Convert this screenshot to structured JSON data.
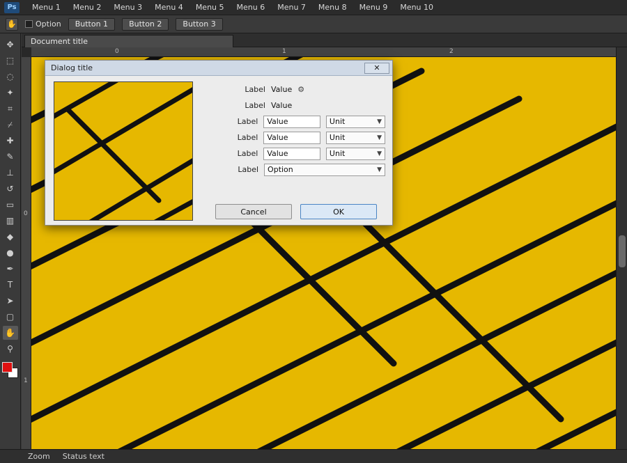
{
  "app": {
    "logo": "Ps"
  },
  "menu": [
    "Menu 1",
    "Menu 2",
    "Menu 3",
    "Menu 4",
    "Menu 5",
    "Menu 6",
    "Menu 7",
    "Menu 8",
    "Menu 9",
    "Menu 10"
  ],
  "options": {
    "tool_icon": "hand-icon",
    "checkbox_label": "Option",
    "buttons": [
      "Button 1",
      "Button 2",
      "Button 3"
    ]
  },
  "document": {
    "tab_title": "Document title"
  },
  "rulers": {
    "top": [
      "0",
      "1",
      "2"
    ],
    "left": [
      "0",
      "1"
    ]
  },
  "tools": [
    "move-icon",
    "marquee-icon",
    "lasso-icon",
    "magic-wand-icon",
    "crop-icon",
    "eyedropper-icon",
    "healing-brush-icon",
    "brush-icon",
    "stamp-icon",
    "history-brush-icon",
    "eraser-icon",
    "gradient-icon",
    "blur-icon",
    "dodge-icon",
    "pen-icon",
    "type-icon",
    "path-select-icon",
    "shape-icon",
    "hand-icon",
    "zoom-icon"
  ],
  "colors": {
    "canvas": "#e6b800",
    "foreground": "#e01010",
    "background": "#ffffff",
    "accent": "#4a84c4"
  },
  "dialog": {
    "title": "Dialog title",
    "close_label": "✕",
    "rows": [
      {
        "label": "Label",
        "value": "Value"
      },
      {
        "label": "Label",
        "value": "Value"
      },
      {
        "label": "Label",
        "input": "Value",
        "unit": "Unit"
      },
      {
        "label": "Label",
        "input": "Value",
        "unit": "Unit"
      },
      {
        "label": "Label",
        "input": "Value",
        "unit": "Unit"
      },
      {
        "label": "Label",
        "select": "Option"
      }
    ],
    "cancel_label": "Cancel",
    "ok_label": "OK"
  },
  "status": {
    "zoom": "Zoom",
    "doc_info": "Status text"
  }
}
